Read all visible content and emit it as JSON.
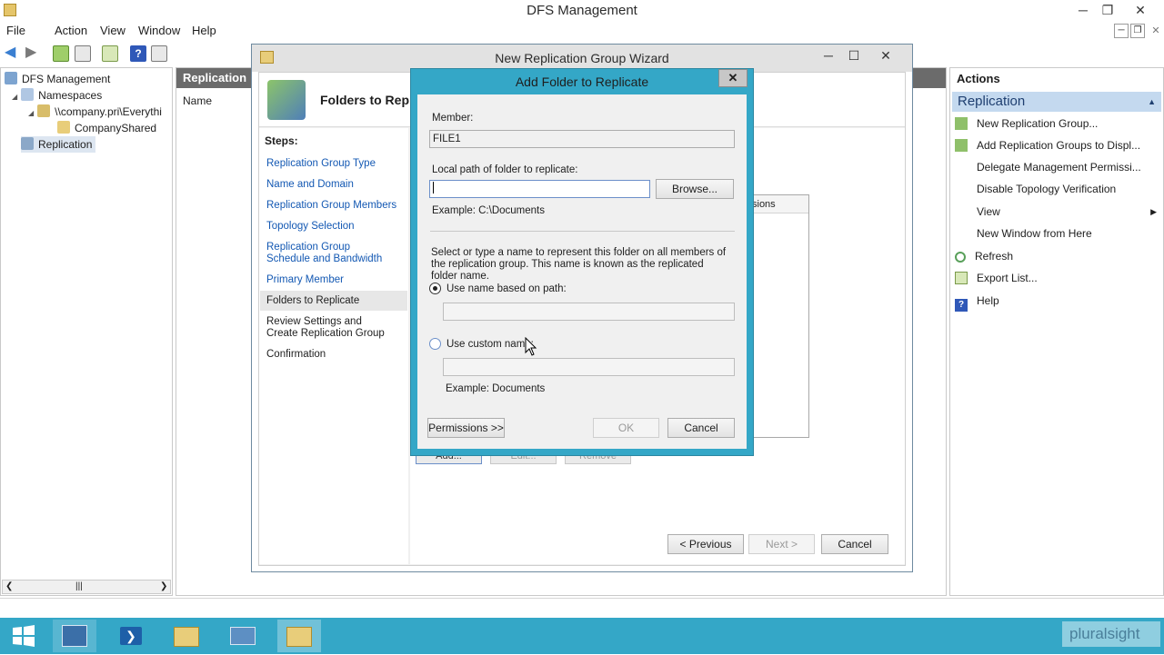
{
  "app": {
    "title": "DFS Management"
  },
  "menu": [
    "File",
    "Action",
    "View",
    "Window",
    "Help"
  ],
  "tree": {
    "root": "DFS Management",
    "namespaces": "Namespaces",
    "namespace_path": "\\\\company.pri\\Everythi",
    "shared": "CompanyShared",
    "replication": "Replication"
  },
  "center": {
    "header": "Replication",
    "column_name": "Name"
  },
  "actions": {
    "header": "Actions",
    "section": "Replication",
    "items": [
      "New Replication Group...",
      "Add Replication Groups to Displ...",
      "Delegate Management Permissi...",
      "Disable Topology Verification",
      "View",
      "New Window from Here",
      "Refresh",
      "Export List...",
      "Help"
    ]
  },
  "wizard": {
    "title": "New Replication Group Wizard",
    "banner_title": "Folders to Rep",
    "steps_label": "Steps:",
    "steps": [
      "Replication Group Type",
      "Name and Domain",
      "Replication Group Members",
      "Topology Selection",
      "Replication Group Schedule and Bandwidth",
      "Primary Member",
      "Folders to Replicate",
      "Review Settings and Create Replication Group",
      "Confirmation"
    ],
    "list_header_fragment": "sions",
    "add_label": "Add...",
    "edit_label": "Edit...",
    "remove_label": "Remove",
    "previous_label": "< Previous",
    "next_label": "Next >",
    "cancel_label": "Cancel"
  },
  "dialog": {
    "title": "Add Folder to Replicate",
    "close_glyph": "✕",
    "member_label": "Member:",
    "member_value": "FILE1",
    "local_path_label": "Local path of folder to replicate:",
    "local_path_value": "",
    "browse_label": "Browse...",
    "local_example": "Example: C:\\Documents",
    "description": "Select or type a name to represent this folder on all members of the replication group. This name is known as the replicated folder name.",
    "radio_path_label": "Use name based on path:",
    "radio_path_value": "",
    "radio_custom_label": "Use custom name:",
    "custom_value": "",
    "custom_example": "Example: Documents",
    "permissions_label": "Permissions >>",
    "ok_label": "OK",
    "cancel_label": "Cancel",
    "selected_option": "path"
  },
  "taskbar": {
    "brand": "pluralsight"
  },
  "colors": {
    "taskbar": "#34a7c7",
    "selection": "#c4d9ef",
    "link": "#1358b3"
  }
}
